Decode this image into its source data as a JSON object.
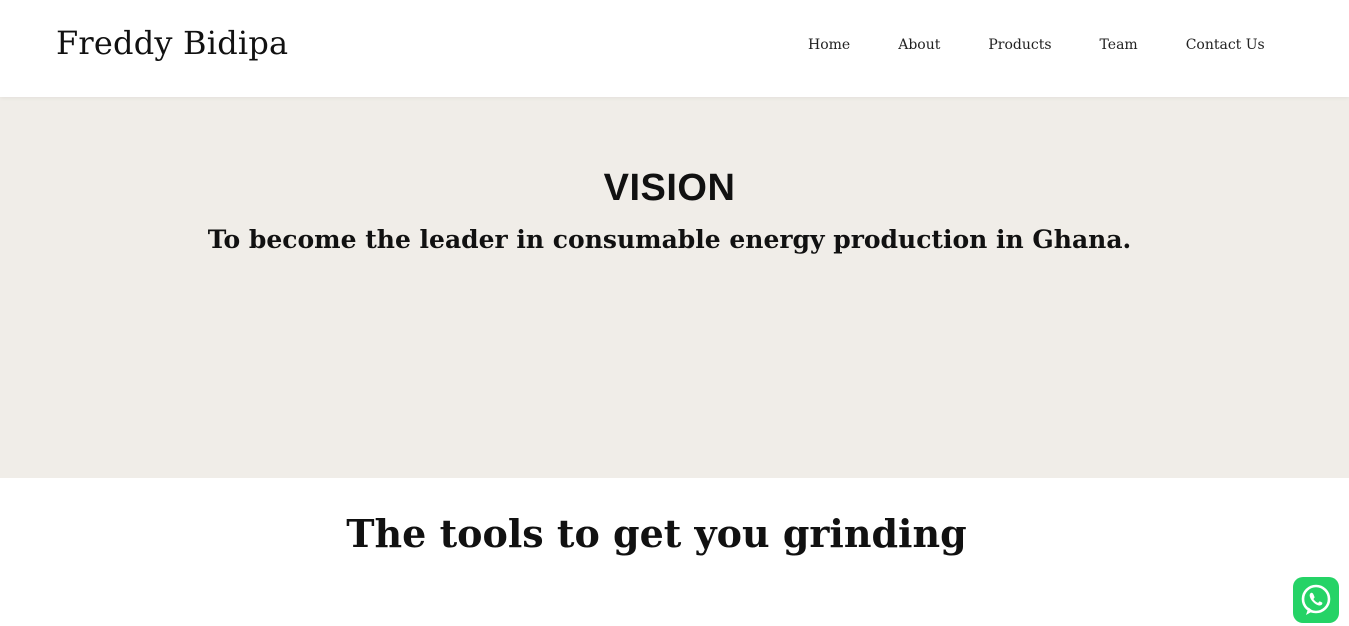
{
  "header": {
    "brand": "Freddy Bidipa",
    "nav": [
      {
        "label": "Home"
      },
      {
        "label": "About"
      },
      {
        "label": "Products"
      },
      {
        "label": "Team"
      },
      {
        "label": "Contact Us"
      }
    ]
  },
  "vision": {
    "title": "VISION",
    "text": "To become the leader in consumable energy production in Ghana."
  },
  "tools": {
    "heading": "The tools to get you grinding"
  },
  "floating": {
    "icon": "whatsapp-icon",
    "color": "#25d366"
  },
  "colors": {
    "section_bg": "#f0ede8",
    "text": "#111111"
  }
}
